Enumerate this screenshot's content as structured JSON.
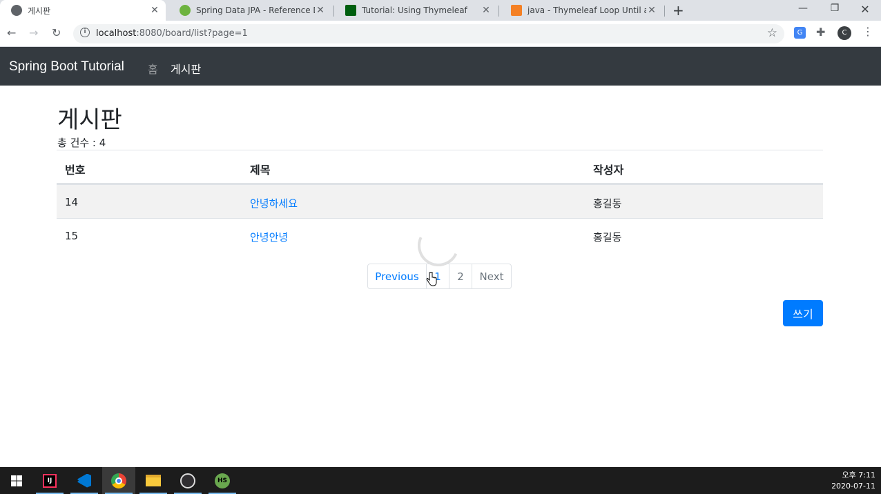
{
  "browser": {
    "tabs": [
      {
        "title": "게시판",
        "active": true
      },
      {
        "title": "Spring Data JPA - Reference Do",
        "active": false
      },
      {
        "title": "Tutorial: Using Thymeleaf",
        "active": false
      },
      {
        "title": "java - Thymeleaf Loop Until a N",
        "active": false
      }
    ],
    "url_host": "localhost",
    "url_rest": ":8080/board/list?page=1",
    "profile_initial": "C"
  },
  "navbar": {
    "brand": "Spring Boot Tutorial",
    "links": [
      "홈",
      "게시판"
    ]
  },
  "main": {
    "title": "게시판",
    "count_label": "총 건수 : 4",
    "columns": [
      "번호",
      "제목",
      "작성자"
    ],
    "rows": [
      {
        "no": "14",
        "title": "안녕하세요",
        "writer": "홍길동"
      },
      {
        "no": "15",
        "title": "안녕안녕",
        "writer": "홍길동"
      }
    ],
    "pagination": {
      "prev": "Previous",
      "pages": [
        "1",
        "2"
      ],
      "next": "Next"
    },
    "write_button": "쓰기"
  },
  "taskbar": {
    "time": "오후 7:11",
    "date": "2020-07-11"
  },
  "colors": {
    "navbar_bg": "#343a40",
    "primary": "#007bff",
    "taskbar_bg": "#1c1c1c"
  }
}
